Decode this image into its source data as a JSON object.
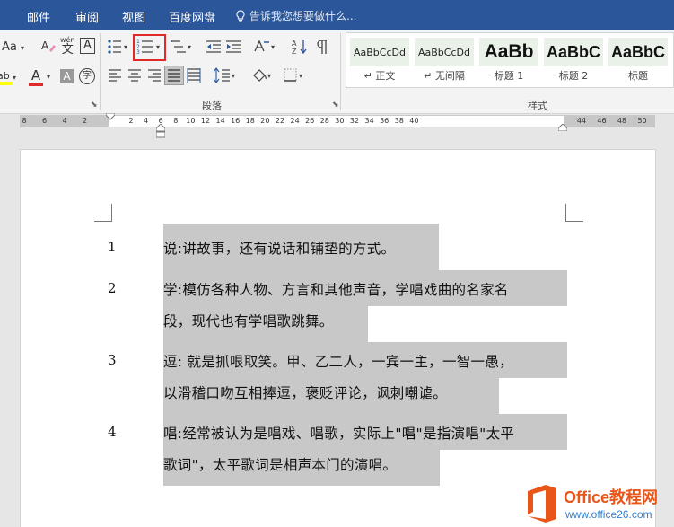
{
  "menu": {
    "items": [
      "邮件",
      "审阅",
      "视图",
      "百度网盘"
    ],
    "tell_me": "告诉我您想要做什么..."
  },
  "ribbon": {
    "font_size_label": "Aa",
    "phonetic_label": "wén",
    "phonetic_char": "文",
    "char_border_label": "A",
    "font_color_label": "A",
    "shading_label": "A",
    "enclose_label": "字",
    "paragraph_group": "段落",
    "styles_group": "样式",
    "highlight_color": "#ffff00",
    "font_color": "#e02a2a",
    "styles": [
      {
        "preview": "AaBbCcDd",
        "name": "正文",
        "cls": "p1",
        "marker": "↵"
      },
      {
        "preview": "AaBbCcDd",
        "name": "无间隔",
        "cls": "p1",
        "marker": "↵"
      },
      {
        "preview": "AaBb",
        "name": "标题 1",
        "cls": "p2",
        "marker": ""
      },
      {
        "preview": "AaBbC",
        "name": "标题 2",
        "cls": "p3",
        "marker": ""
      },
      {
        "preview": "AaBbC",
        "name": "标题",
        "cls": "p3",
        "marker": ""
      }
    ]
  },
  "ruler": {
    "left_ticks": [
      "8",
      "6",
      "4",
      "2"
    ],
    "main_ticks": [
      "2",
      "4",
      "6",
      "8",
      "10",
      "12",
      "14",
      "16",
      "18",
      "20",
      "22",
      "24",
      "26",
      "28",
      "30",
      "32",
      "34",
      "36",
      "38",
      "40"
    ],
    "right_ticks": [
      "44",
      "46",
      "48",
      "50"
    ]
  },
  "document": {
    "items": [
      {
        "num": "1",
        "lines": [
          "说:讲故事，还有说话和铺垫的方式。"
        ]
      },
      {
        "num": "2",
        "lines": [
          "学:模仿各种人物、方言和其他声音，学唱戏曲的名家名",
          "段，现代也有学唱歌跳舞。"
        ]
      },
      {
        "num": "3",
        "lines": [
          "逗: 就是抓哏取笑。甲、乙二人，一宾一主，一智一愚，",
          "以滑稽口吻互相捧逗，褒贬评论，讽刺嘲谑。"
        ]
      },
      {
        "num": "4",
        "lines": [
          "唱:经常被认为是唱戏、唱歌，实际上\"唱\"是指演唱\"太平",
          "歌词\"，太平歌词是相声本门的演唱。"
        ]
      }
    ]
  },
  "watermark": {
    "title": "Office教程网",
    "url": "www.office26.com"
  }
}
